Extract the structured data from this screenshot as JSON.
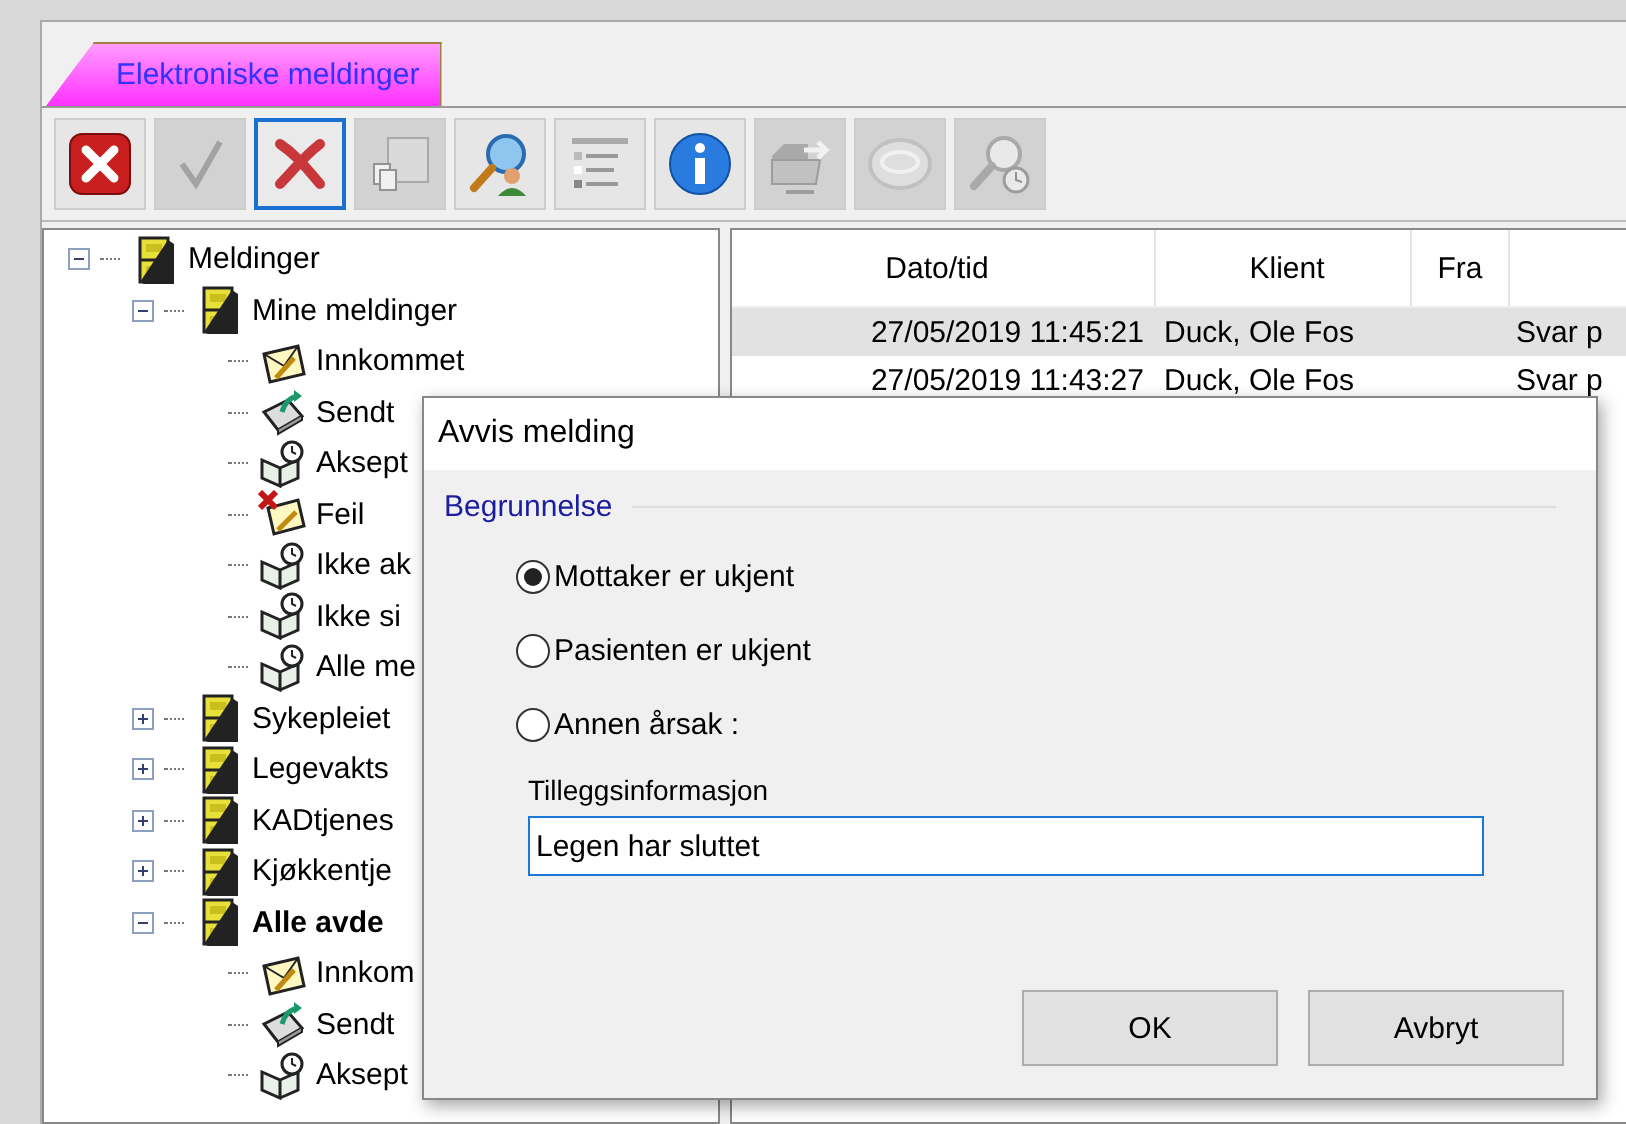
{
  "tab": {
    "label": "Elektroniske meldinger",
    "selected": true
  },
  "toolbar": [
    {
      "kind": "close",
      "disabled": false,
      "focused": false
    },
    {
      "kind": "check",
      "disabled": true,
      "focused": false
    },
    {
      "kind": "reject",
      "disabled": false,
      "focused": true
    },
    {
      "kind": "copy",
      "disabled": true,
      "focused": false
    },
    {
      "kind": "search",
      "disabled": false,
      "focused": false
    },
    {
      "kind": "legend",
      "disabled": false,
      "focused": false
    },
    {
      "kind": "info",
      "disabled": false,
      "focused": false
    },
    {
      "kind": "export",
      "disabled": true,
      "focused": false
    },
    {
      "kind": "disc",
      "disabled": true,
      "focused": false
    },
    {
      "kind": "history",
      "disabled": true,
      "focused": false
    }
  ],
  "tree": [
    {
      "label": "Meldinger",
      "kind": "cabinet",
      "bold": false,
      "expanded": true,
      "children": [
        {
          "label": "Mine meldinger",
          "kind": "cabinet",
          "bold": false,
          "expanded": true,
          "children": [
            {
              "label": "Innkommet",
              "kind": "inbox",
              "bold": false
            },
            {
              "label": "Sendt",
              "kind": "sent",
              "bold": false
            },
            {
              "label": "Aksept",
              "kind": "book",
              "bold": false
            },
            {
              "label": "Feil",
              "kind": "error",
              "bold": false
            },
            {
              "label": "Ikke ak",
              "kind": "book",
              "bold": false
            },
            {
              "label": "Ikke si",
              "kind": "book",
              "bold": false
            },
            {
              "label": "Alle me",
              "kind": "book",
              "bold": false
            }
          ]
        },
        {
          "label": "Sykepleiet",
          "kind": "cabinet",
          "bold": false,
          "expanded": false
        },
        {
          "label": "Legevakts",
          "kind": "cabinet",
          "bold": false,
          "expanded": false
        },
        {
          "label": "KADtjenes",
          "kind": "cabinet",
          "bold": false,
          "expanded": false
        },
        {
          "label": "Kjøkkentje",
          "kind": "cabinet",
          "bold": false,
          "expanded": false
        },
        {
          "label": "Alle avde",
          "kind": "cabinet",
          "bold": true,
          "expanded": true,
          "children": [
            {
              "label": "Innkom",
              "kind": "inbox",
              "bold": false
            },
            {
              "label": "Sendt",
              "kind": "sent",
              "bold": false
            },
            {
              "label": "Aksept",
              "kind": "book",
              "bold": false
            }
          ]
        }
      ]
    }
  ],
  "table": {
    "columns": [
      "Dato/tid",
      "Klient",
      "Fra"
    ],
    "rows": [
      {
        "selected": true,
        "cells": [
          "27/05/2019 11:45:21",
          "Duck, Ole Fos",
          "",
          "Svar p"
        ]
      },
      {
        "selected": false,
        "cells": [
          "27/05/2019 11:43:27",
          "Duck, Ole Fos",
          "",
          "Svar p"
        ]
      }
    ]
  },
  "dialog": {
    "title": "Avvis melding",
    "group": "Begrunnelse",
    "options": [
      {
        "label": "Mottaker er ukjent",
        "selected": true
      },
      {
        "label": "Pasienten er ukjent",
        "selected": false
      },
      {
        "label": "Annen årsak :",
        "selected": false
      }
    ],
    "field_label": "Tilleggsinformasjon",
    "field_value": "Legen har sluttet",
    "buttons": [
      "OK",
      "Avbryt"
    ]
  }
}
